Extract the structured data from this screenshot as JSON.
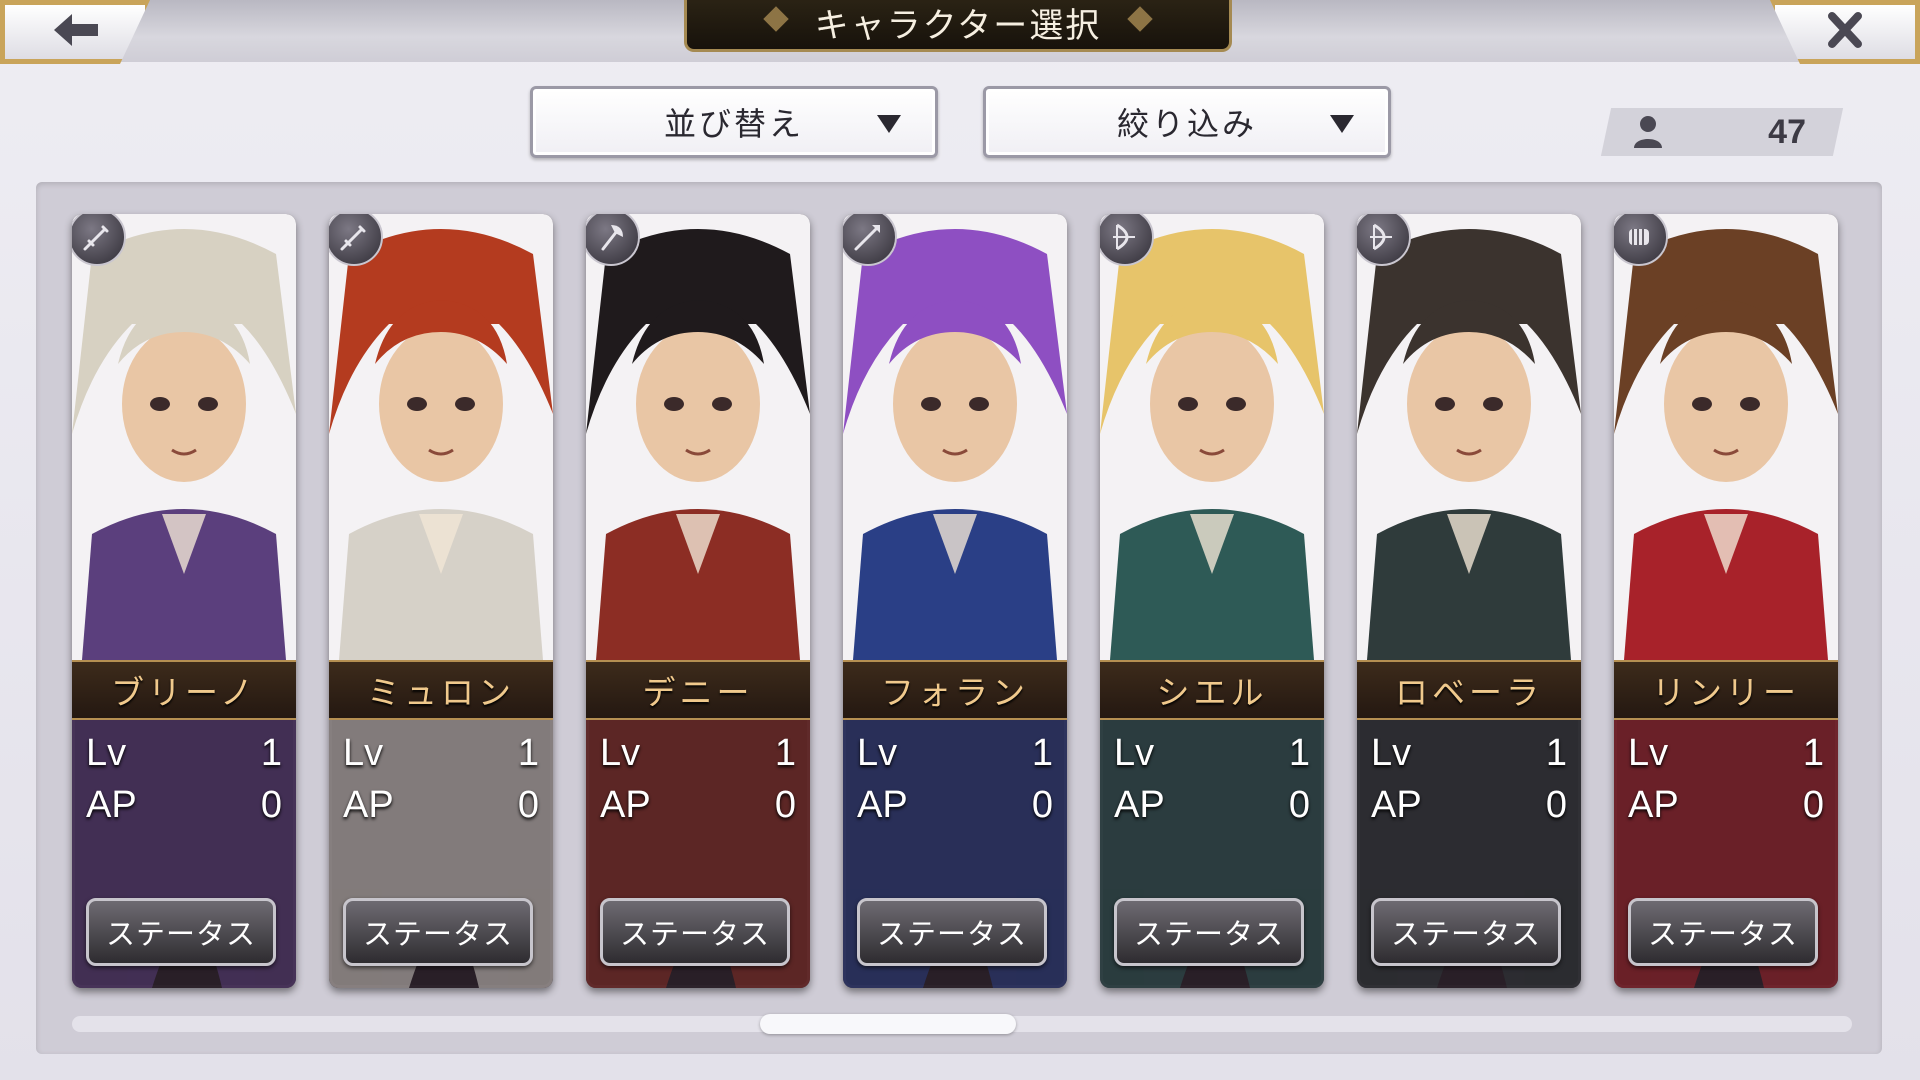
{
  "header": {
    "title": "キャラクター選択",
    "back_icon": "back-arrow-icon",
    "close_icon": "close-icon"
  },
  "toolbar": {
    "sort_label": "並び替え",
    "filter_label": "絞り込み",
    "count": "47"
  },
  "labels": {
    "lv": "Lv",
    "ap": "AP",
    "status": "ステータス"
  },
  "characters": [
    {
      "name": "ブリーノ",
      "lv": "1",
      "ap": "0",
      "class_icon": "sword-icon",
      "hair": "#d7d1c2",
      "accent": "#5b3f7d"
    },
    {
      "name": "ミュロン",
      "lv": "1",
      "ap": "0",
      "class_icon": "sword-icon",
      "hair": "#b43b1f",
      "accent": "#d6d1c8"
    },
    {
      "name": "デニー",
      "lv": "1",
      "ap": "0",
      "class_icon": "axe-icon",
      "hair": "#1f1a1c",
      "accent": "#8c2d24"
    },
    {
      "name": "フォラン",
      "lv": "1",
      "ap": "0",
      "class_icon": "spear-icon",
      "hair": "#8e4fc2",
      "accent": "#2a3f86"
    },
    {
      "name": "シエル",
      "lv": "1",
      "ap": "0",
      "class_icon": "bow-icon",
      "hair": "#e7c46a",
      "accent": "#2e5a56"
    },
    {
      "name": "ロベーラ",
      "lv": "1",
      "ap": "0",
      "class_icon": "bow-icon",
      "hair": "#3b332e",
      "accent": "#2f3b3b"
    },
    {
      "name": "リンリー",
      "lv": "1",
      "ap": "0",
      "class_icon": "fist-icon",
      "hair": "#6b4025",
      "accent": "#a8222a"
    }
  ],
  "colors": {
    "gold": "#c9a45a",
    "name_text": "#f0c98c",
    "panel": "#cfccd6"
  }
}
